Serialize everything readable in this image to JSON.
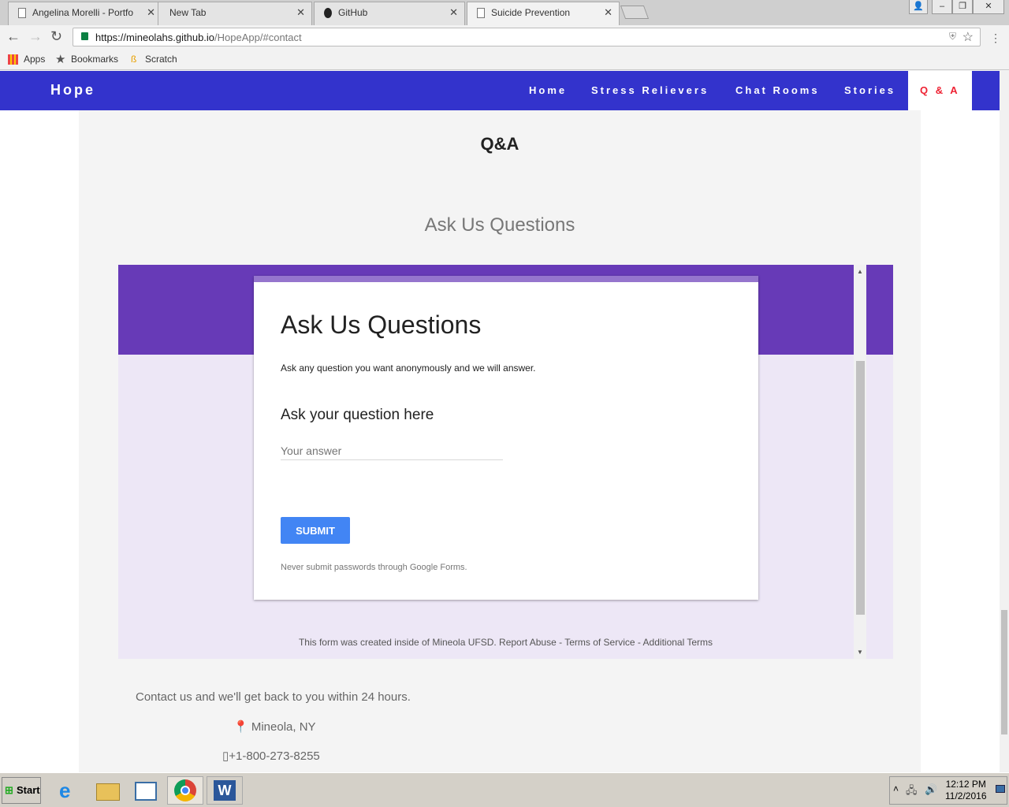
{
  "browser": {
    "tabs": [
      {
        "title": "Angelina Morelli - Portfo"
      },
      {
        "title": "New Tab"
      },
      {
        "title": "GitHub"
      },
      {
        "title": "Suicide Prevention"
      }
    ],
    "url_host": "https://mineolahs.github.io",
    "url_path": "/HopeApp/#contact",
    "bookmarks": [
      "Apps",
      "Bookmarks",
      "Scratch"
    ]
  },
  "site": {
    "brand": "Hope",
    "nav": [
      "Home",
      "Stress Relievers",
      "Chat Rooms",
      "Stories",
      "Q & A"
    ],
    "section_title": "Q&A",
    "section_subtitle": "Ask Us Questions"
  },
  "form": {
    "title": "Ask Us Questions",
    "description": "Ask any question you want anonymously and we will answer.",
    "question": "Ask your question here",
    "answer_placeholder": "Your answer",
    "submit_label": "SUBMIT",
    "warning": "Never submit passwords through Google Forms.",
    "footer": "This form was created inside of Mineola UFSD. Report Abuse - Terms of Service - Additional Terms",
    "header_color": "#673ab7",
    "accent_color": "#4285f4"
  },
  "contact": {
    "blurb": "Contact us and we'll get back to you within 24 hours.",
    "location": "Mineola, NY",
    "phone": "+1-800-273-8255"
  },
  "taskbar": {
    "start_label": "Start",
    "time": "12:12 PM",
    "date": "11/2/2016"
  }
}
